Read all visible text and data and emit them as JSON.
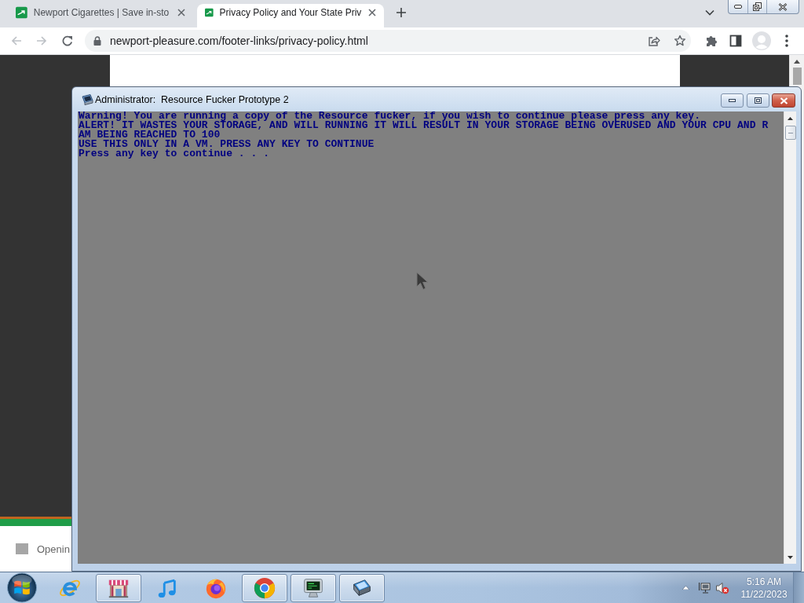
{
  "browser": {
    "tabs": [
      {
        "title": "Newport Cigarettes | Save in-sto",
        "selected": false
      },
      {
        "title": "Privacy Policy and Your State Priv",
        "selected": true
      }
    ],
    "back": {
      "disabled": true
    },
    "forward": {
      "disabled": true
    },
    "address": "newport-pleasure.com/footer-links/privacy-policy.html",
    "page": {
      "notice": "Openin"
    }
  },
  "console_window": {
    "title": "Administrator:  Resource Fucker Prototype 2",
    "lines": [
      "Warning! You are running a copy of the Resource fucker, if you wish to continue please press any key.",
      "ALERT! IT WASTES YOUR STORAGE, AND WILL RUNNING IT WILL RESULT IN YOUR STORAGE BEING OVERUSED AND YOUR CPU AND R",
      "AM BEING REACHED TO 100",
      "USE THIS ONLY IN A VM. PRESS ANY KEY TO CONTINUE",
      "Press any key to continue . . ."
    ]
  },
  "taskbar": {
    "items": [
      {
        "running": false
      },
      {
        "running": true
      },
      {
        "running": false
      },
      {
        "running": false
      },
      {
        "running": true
      },
      {
        "running": true
      },
      {
        "running": true
      }
    ],
    "tray": {
      "volume_muted": true
    },
    "clock": {
      "time": "5:16 AM",
      "date": "11/22/2023"
    }
  }
}
